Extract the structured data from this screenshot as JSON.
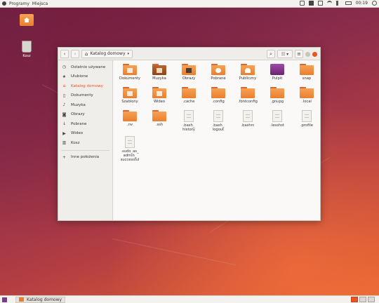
{
  "top_panel": {
    "menu_programs": "Programy",
    "menu_places": "Miejsca",
    "clock": "00:19"
  },
  "desktop": {
    "home_label": "",
    "trash_label": "Kosz"
  },
  "window": {
    "location_label": "Katalog domowy"
  },
  "sidebar": {
    "items": [
      {
        "label": "Ostatnio używane",
        "icon": "clock-icon"
      },
      {
        "label": "Ulubione",
        "icon": "star-icon"
      },
      {
        "label": "Katalog domowy",
        "icon": "home-icon",
        "active": true
      },
      {
        "label": "Dokumenty",
        "icon": "document-icon"
      },
      {
        "label": "Muzyka",
        "icon": "music-icon"
      },
      {
        "label": "Obrazy",
        "icon": "camera-icon"
      },
      {
        "label": "Pobrane",
        "icon": "download-icon"
      },
      {
        "label": "Wideo",
        "icon": "video-icon"
      },
      {
        "label": "Kosz",
        "icon": "trash-icon"
      },
      {
        "label": "Inne położenia",
        "icon": "plus-icon"
      }
    ]
  },
  "files": [
    {
      "name": "Dokumenty",
      "kind": "folder"
    },
    {
      "name": "Muzyka",
      "kind": "folder"
    },
    {
      "name": "Obrazy",
      "kind": "folder"
    },
    {
      "name": "Pobrane",
      "kind": "folder"
    },
    {
      "name": "Publiczny",
      "kind": "folder"
    },
    {
      "name": "Pulpit",
      "kind": "desktop-folder"
    },
    {
      "name": "snap",
      "kind": "folder"
    },
    {
      "name": "Szablony",
      "kind": "folder"
    },
    {
      "name": "Wideo",
      "kind": "folder"
    },
    {
      "name": ".cache",
      "kind": "folder"
    },
    {
      "name": ".config",
      "kind": "folder"
    },
    {
      "name": ".fontconfig",
      "kind": "folder"
    },
    {
      "name": ".gnupg",
      "kind": "folder"
    },
    {
      "name": ".local",
      "kind": "folder"
    },
    {
      "name": ".nv",
      "kind": "folder"
    },
    {
      "name": ".ssh",
      "kind": "folder"
    },
    {
      "name": ".bash_history",
      "line1": ".bash_",
      "line2": "history",
      "kind": "file"
    },
    {
      "name": ".bash_logout",
      "line1": ".bash_",
      "line2": "logout",
      "kind": "file"
    },
    {
      "name": ".bashrc",
      "kind": "file"
    },
    {
      "name": ".lesshst",
      "kind": "file"
    },
    {
      "name": ".profile",
      "kind": "file"
    },
    {
      "name": ".sudo_as_admin_successful",
      "line1": ".sudo_as_",
      "line2": "admin_",
      "line3": "successful",
      "kind": "file"
    }
  ],
  "bottom_panel": {
    "task_label": "Katalog domowy"
  },
  "colors": {
    "accent": "#e95420",
    "folder": "#f08a3a",
    "pulpit": "#7c3a8c"
  }
}
